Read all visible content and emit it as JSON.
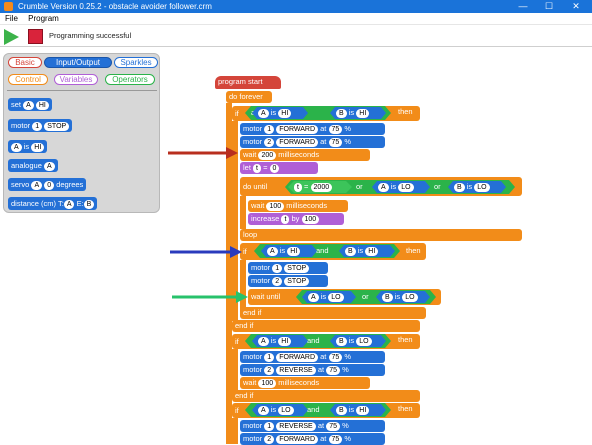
{
  "window": {
    "title": "Crumble Version 0.25.2 - obstacle avoider follower.crm",
    "min": "—",
    "max": "☐",
    "close": "✕"
  },
  "menu": {
    "file": "File",
    "program": "Program"
  },
  "toolbar": {
    "status": "Programming successful"
  },
  "palette": {
    "categories": [
      "Basic",
      "Input/Output",
      "Sparkles",
      "Control",
      "Variables",
      "Operators"
    ],
    "blocks": {
      "set": "set",
      "set_var": "A",
      "set_val": "HI",
      "motor": "motor",
      "motor_num": "1",
      "motor_val": "STOP",
      "is_var": "A",
      "is_word": "is",
      "is_val": "HI",
      "analogue": "analogue",
      "analogue_var": "A",
      "servo": "servo",
      "servo_var": "A",
      "servo_num": "0",
      "servo_unit": "degrees",
      "distance": "distance (cm)",
      "distance_t": "T:",
      "distance_a": "A",
      "distance_e": "E:",
      "distance_b": "B"
    }
  },
  "program": {
    "start": "program start",
    "do_forever": "do forever",
    "if": "if",
    "then": "then",
    "and": "and",
    "or": "or",
    "is": "is",
    "A": "A",
    "B": "B",
    "HI": "HI",
    "LO": "LO",
    "motor": "motor",
    "at": "at",
    "pct": "%",
    "m1": "1",
    "m2": "2",
    "forward": "FORWARD",
    "reverse": "REVERSE",
    "stop": "STOP",
    "speed": "75",
    "wait": "wait",
    "ms": "milliseconds",
    "w200": "200",
    "w100": "100",
    "let": "let",
    "t": "t",
    "eq": "=",
    "zero": "0",
    "do_until": "do until",
    "v2000": "2000",
    "increase": "increase",
    "by": "by",
    "loop": "loop",
    "wait_until": "wait until",
    "end_if": "end if"
  },
  "colors": {
    "control": "#f28c19",
    "io": "#2470d6",
    "var": "#b05fd6",
    "op": "#2bb34a",
    "title": "#1a73d9"
  }
}
